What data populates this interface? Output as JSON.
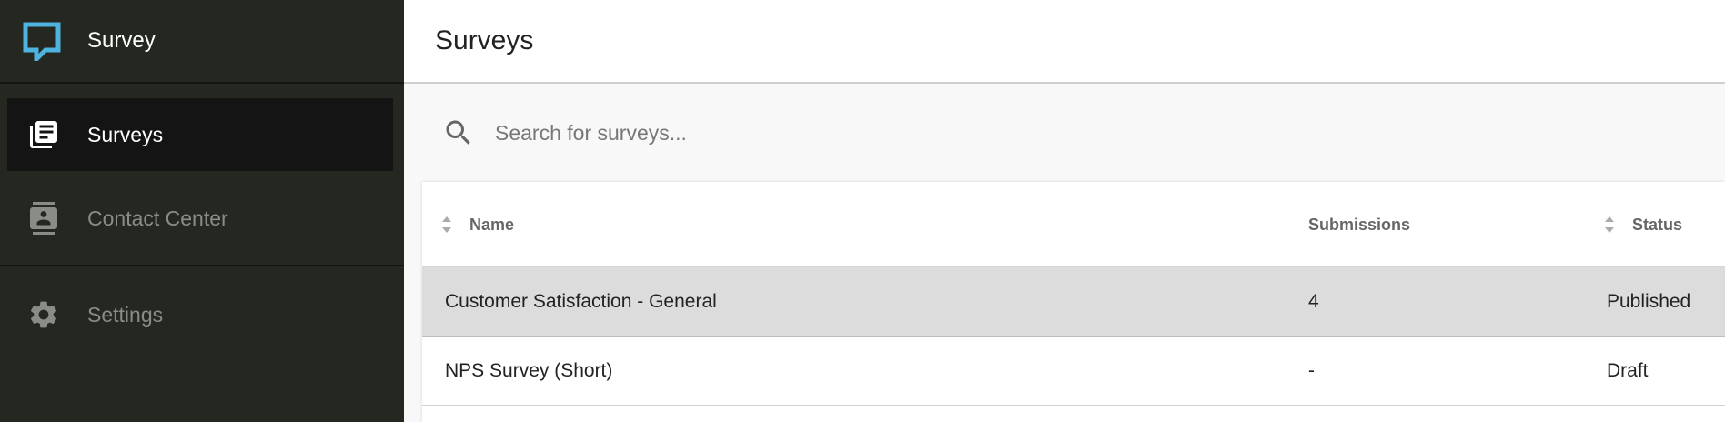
{
  "brand": {
    "name": "Survey",
    "logo_icon": "chat-bubble-logo-icon",
    "logo_color": "#4fb3e0"
  },
  "sidebar": {
    "items": [
      {
        "label": "Surveys",
        "icon": "library-books-icon",
        "active": true
      },
      {
        "label": "Contact Center",
        "icon": "contact-card-icon",
        "active": false
      },
      {
        "label": "Settings",
        "icon": "gear-icon",
        "active": false
      }
    ],
    "bg_color": "#242820",
    "active_bg": "#141414"
  },
  "header": {
    "title": "Surveys"
  },
  "search": {
    "placeholder": "Search for surveys...",
    "value": "",
    "icon": "search-icon"
  },
  "table": {
    "columns": [
      {
        "label": "Name",
        "sortable": true
      },
      {
        "label": "Submissions",
        "sortable": false
      },
      {
        "label": "Status",
        "sortable": true
      }
    ],
    "rows": [
      {
        "name": "Customer Satisfaction - General",
        "submissions": "4",
        "status": "Published",
        "selected": true
      },
      {
        "name": "NPS Survey (Short)",
        "submissions": "-",
        "status": "Draft",
        "selected": false
      }
    ]
  }
}
